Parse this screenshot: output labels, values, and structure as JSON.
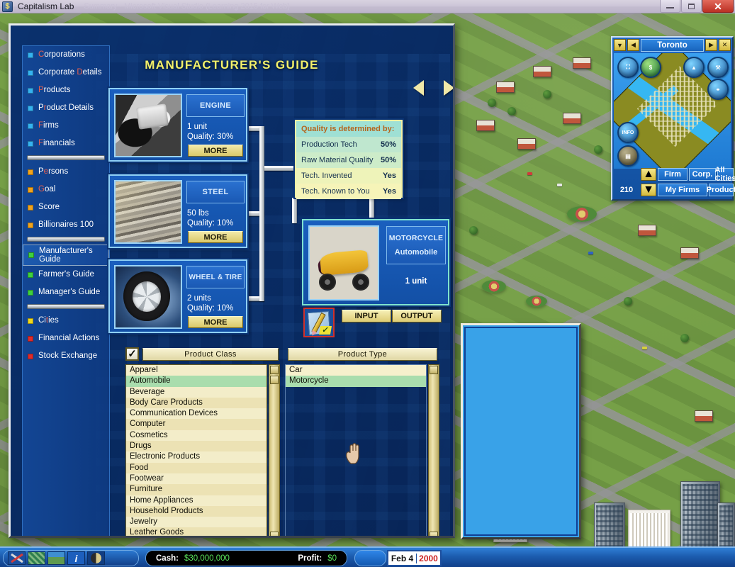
{
  "window": {
    "title": "Capitalism Lab",
    "ghost_text": "Summary - Microsoft Visual Studio (Learning 2015 for Web)",
    "minimize_label": "Minimize",
    "maximize_label": "Maximize",
    "close_label": "Close"
  },
  "dialog": {
    "title": "MANUFACTURER'S GUIDE",
    "prev_label": "Previous",
    "next_label": "Next"
  },
  "sidebar": {
    "groups": [
      {
        "items": [
          {
            "label": "Corporations",
            "hotkey": "C",
            "color": "#35b2f0"
          },
          {
            "label": "Corporate Details",
            "hotkey": "D",
            "color": "#35b2f0"
          },
          {
            "label": "Products",
            "hotkey": "P",
            "color": "#35b2f0"
          },
          {
            "label": "Product Details",
            "hotkey": "r",
            "color": "#35b2f0"
          },
          {
            "label": "Firms",
            "hotkey": "F",
            "color": "#35b2f0"
          },
          {
            "label": "Financials",
            "hotkey": "F",
            "color": "#35b2f0"
          }
        ]
      },
      {
        "items": [
          {
            "label": "Persons",
            "hotkey": "e",
            "color": "#f0a41e"
          },
          {
            "label": "Goal",
            "hotkey": "G",
            "color": "#f0a41e"
          },
          {
            "label": "Score",
            "hotkey": "",
            "color": "#f0a41e"
          },
          {
            "label": "Billionaires 100",
            "hotkey": "",
            "color": "#f0a41e"
          }
        ]
      },
      {
        "items": [
          {
            "label": "Manufacturer's Guide",
            "hotkey": "",
            "color": "#3ed13e",
            "selected": true
          },
          {
            "label": "Farmer's Guide",
            "hotkey": "",
            "color": "#3ed13e"
          },
          {
            "label": "Manager's Guide",
            "hotkey": "",
            "color": "#3ed13e"
          }
        ]
      },
      {
        "items": [
          {
            "label": "Cities",
            "hotkey": "t",
            "color": "#f0d81e"
          },
          {
            "label": "Financial Actions",
            "hotkey": "",
            "color": "#e02b2b"
          },
          {
            "label": "Stock Exchange",
            "hotkey": "",
            "color": "#e02b2b"
          }
        ]
      }
    ]
  },
  "inputs": [
    {
      "name": "ENGINE",
      "quantity": "1 unit",
      "quality": "Quality: 30%",
      "more_label": "MORE",
      "art": "engine"
    },
    {
      "name": "STEEL",
      "quantity": "50 lbs",
      "quality": "Quality: 10%",
      "more_label": "MORE",
      "art": "steel"
    },
    {
      "name": "WHEEL & TIRE",
      "quantity": "2 units",
      "quality": "Quality: 10%",
      "more_label": "MORE",
      "art": "wheel"
    }
  ],
  "quality_box": {
    "header": "Quality is determined by:",
    "rows": [
      {
        "label": "Production Tech",
        "value": "50%"
      },
      {
        "label": "Raw Material Quality",
        "value": "50%"
      },
      {
        "label": "Tech. Invented",
        "value": "Yes"
      },
      {
        "label": "Tech. Known to You",
        "value": "Yes"
      }
    ]
  },
  "output": {
    "name": "MOTORCYCLE",
    "class": "Automobile",
    "units": "1 unit",
    "edit_tool_label": "Edit",
    "input_label": "INPUT",
    "output_label": "OUTPUT"
  },
  "lists": {
    "enable_checkbox_checked": true,
    "product_class_header": "Product Class",
    "product_type_header": "Product Type",
    "product_classes": [
      "Apparel",
      "Automobile",
      "Beverage",
      "Body Care Products",
      "Communication Devices",
      "Computer",
      "Cosmetics",
      "Drugs",
      "Electronic Products",
      "Food",
      "Footwear",
      "Furniture",
      "Home Appliances",
      "Household Products",
      "Jewelry",
      "Leather Goods"
    ],
    "selected_class": "Automobile",
    "product_types": [
      "Car",
      "Motorcycle"
    ],
    "selected_type": "Motorcycle"
  },
  "minimap": {
    "city": "Toronto",
    "menu_icon": "chevron-down-icon",
    "prev_icon": "chevron-left-icon",
    "next_icon": "chevron-right-icon",
    "close_icon": "close-icon",
    "tools": [
      {
        "name": "buildings-icon",
        "glyph": "⌂"
      },
      {
        "name": "money-icon",
        "glyph": "$"
      },
      {
        "name": "chart-icon",
        "glyph": "█"
      },
      {
        "name": "hammer-icon",
        "glyph": "⚒"
      },
      {
        "name": "link-icon",
        "glyph": "⚭"
      },
      {
        "name": "info-icon",
        "glyph": "INFO"
      },
      {
        "name": "warehouse-icon",
        "glyph": "▤"
      }
    ],
    "counter": "210",
    "buttons": {
      "firm": "Firm",
      "corp": "Corp.",
      "all_cities": "All Cities",
      "my_firms": "My Firms",
      "product": "Product"
    },
    "up_arrow": "▲",
    "down_arrow": "▼"
  },
  "hud": {
    "icons": [
      {
        "name": "tools-icon",
        "label": "Tools"
      },
      {
        "name": "map-icon",
        "label": "City Map"
      },
      {
        "name": "world-icon",
        "label": "World Map"
      },
      {
        "name": "info-icon",
        "label": "Information"
      },
      {
        "name": "speed-icon",
        "label": "Game Speed"
      }
    ],
    "cash_label": "Cash:",
    "cash_value": "$30,000,000",
    "profit_label": "Profit:",
    "profit_value": "$0",
    "date": "Feb 4",
    "year": "2000"
  }
}
